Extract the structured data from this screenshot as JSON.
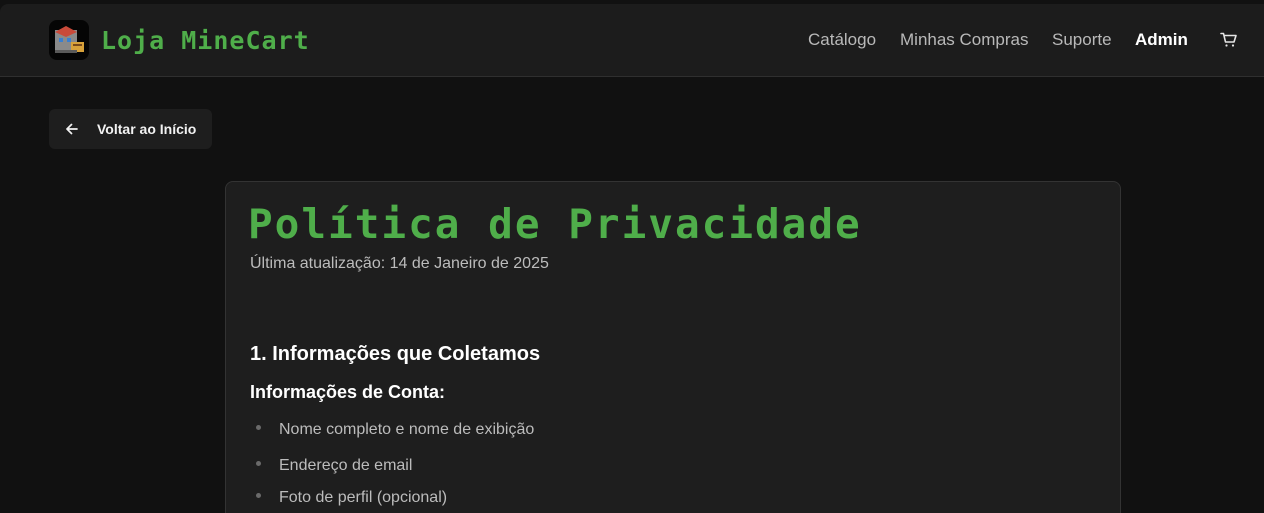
{
  "header": {
    "brand": "Loja MineCart",
    "nav": [
      {
        "label": "Catálogo"
      },
      {
        "label": "Minhas Compras"
      },
      {
        "label": "Suporte"
      },
      {
        "label": "Admin"
      }
    ],
    "cart_icon": "shopping-cart-icon",
    "logo_icon": "shop-block-logo"
  },
  "back_button": {
    "label": "Voltar ao Início",
    "icon": "arrow-left-icon"
  },
  "policy": {
    "title": "Política de Privacidade",
    "updated": "Última atualização: 14 de Janeiro de 2025",
    "section_title": "1. Informações que Coletamos",
    "subsection_title": "Informações de Conta:",
    "items": [
      "Nome completo e nome de exibição",
      "Endereço de email",
      "Foto de perfil (opcional)"
    ]
  },
  "colors": {
    "accent_green": "#4fae4a",
    "background": "#111111",
    "card": "#1e1e1e",
    "topbar": "#1c1c1c"
  }
}
